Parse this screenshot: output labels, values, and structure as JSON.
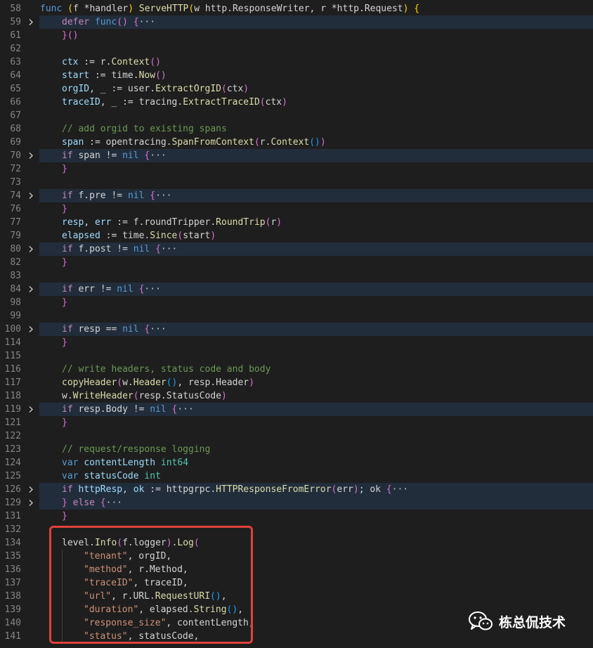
{
  "editor": {
    "lines": [
      {
        "num": "58",
        "fold": false,
        "indent": 0,
        "tokens": [
          [
            "kw",
            "func"
          ],
          [
            "op",
            " "
          ],
          [
            "b1",
            "("
          ],
          [
            "op",
            "f *handler"
          ],
          [
            "b1",
            ")"
          ],
          [
            "op",
            " "
          ],
          [
            "fn",
            "ServeHTTP"
          ],
          [
            "b1",
            "("
          ],
          [
            "op",
            "w http.ResponseWriter, r *http.Request"
          ],
          [
            "b1",
            ")"
          ],
          [
            "op",
            " "
          ],
          [
            "b1",
            "{"
          ]
        ]
      },
      {
        "num": "59",
        "fold": true,
        "indent": 1,
        "tokens": [
          [
            "ctl",
            "defer"
          ],
          [
            "op",
            " "
          ],
          [
            "kw",
            "func"
          ],
          [
            "b2",
            "()"
          ],
          [
            "op",
            " "
          ],
          [
            "b2",
            "{"
          ],
          [
            "ell",
            "···"
          ]
        ]
      },
      {
        "num": "61",
        "fold": false,
        "indent": 1,
        "tokens": [
          [
            "b2",
            "}"
          ],
          [
            "b2",
            "()"
          ]
        ]
      },
      {
        "num": "62",
        "fold": false,
        "indent": 1,
        "tokens": []
      },
      {
        "num": "63",
        "fold": false,
        "indent": 1,
        "tokens": [
          [
            "var",
            "ctx"
          ],
          [
            "op",
            " := r."
          ],
          [
            "fn",
            "Context"
          ],
          [
            "b2",
            "()"
          ]
        ]
      },
      {
        "num": "64",
        "fold": false,
        "indent": 1,
        "tokens": [
          [
            "var",
            "start"
          ],
          [
            "op",
            " := time."
          ],
          [
            "fn",
            "Now"
          ],
          [
            "b2",
            "()"
          ]
        ]
      },
      {
        "num": "65",
        "fold": false,
        "indent": 1,
        "tokens": [
          [
            "var",
            "orgID"
          ],
          [
            "op",
            ", _ := user."
          ],
          [
            "fn",
            "ExtractOrgID"
          ],
          [
            "b2",
            "("
          ],
          [
            "op",
            "ctx"
          ],
          [
            "b2",
            ")"
          ]
        ]
      },
      {
        "num": "66",
        "fold": false,
        "indent": 1,
        "tokens": [
          [
            "var",
            "traceID"
          ],
          [
            "op",
            ", _ := tracing."
          ],
          [
            "fn",
            "ExtractTraceID"
          ],
          [
            "b2",
            "("
          ],
          [
            "op",
            "ctx"
          ],
          [
            "b2",
            ")"
          ]
        ]
      },
      {
        "num": "67",
        "fold": false,
        "indent": 1,
        "tokens": []
      },
      {
        "num": "68",
        "fold": false,
        "indent": 1,
        "tokens": [
          [
            "cmt",
            "// add orgid to existing spans"
          ]
        ]
      },
      {
        "num": "69",
        "fold": false,
        "indent": 1,
        "tokens": [
          [
            "var",
            "span"
          ],
          [
            "op",
            " := opentracing."
          ],
          [
            "fn",
            "SpanFromContext"
          ],
          [
            "b2",
            "("
          ],
          [
            "op",
            "r."
          ],
          [
            "fn",
            "Context"
          ],
          [
            "b3",
            "()"
          ],
          [
            "b2",
            ")"
          ]
        ]
      },
      {
        "num": "70",
        "fold": true,
        "indent": 1,
        "tokens": [
          [
            "ctl",
            "if"
          ],
          [
            "op",
            " span != "
          ],
          [
            "kw",
            "nil"
          ],
          [
            "op",
            " "
          ],
          [
            "b2",
            "{"
          ],
          [
            "ell",
            "···"
          ]
        ]
      },
      {
        "num": "72",
        "fold": false,
        "indent": 1,
        "tokens": [
          [
            "b2",
            "}"
          ]
        ]
      },
      {
        "num": "73",
        "fold": false,
        "indent": 1,
        "tokens": []
      },
      {
        "num": "74",
        "fold": true,
        "indent": 1,
        "tokens": [
          [
            "ctl",
            "if"
          ],
          [
            "op",
            " f.pre != "
          ],
          [
            "kw",
            "nil"
          ],
          [
            "op",
            " "
          ],
          [
            "b2",
            "{"
          ],
          [
            "ell",
            "···"
          ]
        ]
      },
      {
        "num": "76",
        "fold": false,
        "indent": 1,
        "tokens": [
          [
            "b2",
            "}"
          ]
        ]
      },
      {
        "num": "77",
        "fold": false,
        "indent": 1,
        "tokens": [
          [
            "var",
            "resp"
          ],
          [
            "op",
            ", "
          ],
          [
            "var",
            "err"
          ],
          [
            "op",
            " := f.roundTripper."
          ],
          [
            "fn",
            "RoundTrip"
          ],
          [
            "b2",
            "("
          ],
          [
            "op",
            "r"
          ],
          [
            "b2",
            ")"
          ]
        ]
      },
      {
        "num": "79",
        "fold": false,
        "indent": 1,
        "tokens": [
          [
            "var",
            "elapsed"
          ],
          [
            "op",
            " := time."
          ],
          [
            "fn",
            "Since"
          ],
          [
            "b2",
            "("
          ],
          [
            "op",
            "start"
          ],
          [
            "b2",
            ")"
          ]
        ]
      },
      {
        "num": "80",
        "fold": true,
        "indent": 1,
        "tokens": [
          [
            "ctl",
            "if"
          ],
          [
            "op",
            " f.post != "
          ],
          [
            "kw",
            "nil"
          ],
          [
            "op",
            " "
          ],
          [
            "b2",
            "{"
          ],
          [
            "ell",
            "···"
          ]
        ]
      },
      {
        "num": "82",
        "fold": false,
        "indent": 1,
        "tokens": [
          [
            "b2",
            "}"
          ]
        ]
      },
      {
        "num": "83",
        "fold": false,
        "indent": 1,
        "tokens": []
      },
      {
        "num": "84",
        "fold": true,
        "indent": 1,
        "tokens": [
          [
            "ctl",
            "if"
          ],
          [
            "op",
            " err != "
          ],
          [
            "kw",
            "nil"
          ],
          [
            "op",
            " "
          ],
          [
            "b2",
            "{"
          ],
          [
            "ell",
            "···"
          ]
        ]
      },
      {
        "num": "98",
        "fold": false,
        "indent": 1,
        "tokens": [
          [
            "b2",
            "}"
          ]
        ]
      },
      {
        "num": "99",
        "fold": false,
        "indent": 1,
        "tokens": []
      },
      {
        "num": "100",
        "fold": true,
        "indent": 1,
        "tokens": [
          [
            "ctl",
            "if"
          ],
          [
            "op",
            " resp == "
          ],
          [
            "kw",
            "nil"
          ],
          [
            "op",
            " "
          ],
          [
            "b2",
            "{"
          ],
          [
            "ell",
            "···"
          ]
        ]
      },
      {
        "num": "114",
        "fold": false,
        "indent": 1,
        "tokens": [
          [
            "b2",
            "}"
          ]
        ]
      },
      {
        "num": "115",
        "fold": false,
        "indent": 1,
        "tokens": []
      },
      {
        "num": "116",
        "fold": false,
        "indent": 1,
        "tokens": [
          [
            "cmt",
            "// write headers, status code and body"
          ]
        ]
      },
      {
        "num": "117",
        "fold": false,
        "indent": 1,
        "tokens": [
          [
            "fn",
            "copyHeader"
          ],
          [
            "b2",
            "("
          ],
          [
            "op",
            "w."
          ],
          [
            "fn",
            "Header"
          ],
          [
            "b3",
            "()"
          ],
          [
            "op",
            ", resp.Header"
          ],
          [
            "b2",
            ")"
          ]
        ]
      },
      {
        "num": "118",
        "fold": false,
        "indent": 1,
        "tokens": [
          [
            "op",
            "w."
          ],
          [
            "fn",
            "WriteHeader"
          ],
          [
            "b2",
            "("
          ],
          [
            "op",
            "resp.StatusCode"
          ],
          [
            "b2",
            ")"
          ]
        ]
      },
      {
        "num": "119",
        "fold": true,
        "indent": 1,
        "tokens": [
          [
            "ctl",
            "if"
          ],
          [
            "op",
            " resp.Body != "
          ],
          [
            "kw",
            "nil"
          ],
          [
            "op",
            " "
          ],
          [
            "b2",
            "{"
          ],
          [
            "ell",
            "···"
          ]
        ]
      },
      {
        "num": "121",
        "fold": false,
        "indent": 1,
        "tokens": [
          [
            "b2",
            "}"
          ]
        ]
      },
      {
        "num": "122",
        "fold": false,
        "indent": 1,
        "tokens": []
      },
      {
        "num": "123",
        "fold": false,
        "indent": 1,
        "tokens": [
          [
            "cmt",
            "// request/response logging"
          ]
        ]
      },
      {
        "num": "124",
        "fold": false,
        "indent": 1,
        "tokens": [
          [
            "kw",
            "var"
          ],
          [
            "op",
            " "
          ],
          [
            "var",
            "contentLength"
          ],
          [
            "op",
            " "
          ],
          [
            "type",
            "int64"
          ]
        ]
      },
      {
        "num": "125",
        "fold": false,
        "indent": 1,
        "tokens": [
          [
            "kw",
            "var"
          ],
          [
            "op",
            " "
          ],
          [
            "var",
            "statusCode"
          ],
          [
            "op",
            " "
          ],
          [
            "type",
            "int"
          ]
        ]
      },
      {
        "num": "126",
        "fold": true,
        "indent": 1,
        "tokens": [
          [
            "ctl",
            "if"
          ],
          [
            "op",
            " "
          ],
          [
            "var",
            "httpResp"
          ],
          [
            "op",
            ", "
          ],
          [
            "var",
            "ok"
          ],
          [
            "op",
            " := httpgrpc."
          ],
          [
            "fn",
            "HTTPResponseFromError"
          ],
          [
            "b2",
            "("
          ],
          [
            "op",
            "err"
          ],
          [
            "b2",
            ")"
          ],
          [
            "op",
            "; ok "
          ],
          [
            "b2",
            "{"
          ],
          [
            "ell",
            "···"
          ]
        ]
      },
      {
        "num": "129",
        "fold": true,
        "indent": 1,
        "tokens": [
          [
            "b2",
            "}"
          ],
          [
            "op",
            " "
          ],
          [
            "ctl",
            "else"
          ],
          [
            "op",
            " "
          ],
          [
            "b2",
            "{"
          ],
          [
            "ell",
            "···"
          ]
        ]
      },
      {
        "num": "131",
        "fold": false,
        "indent": 1,
        "tokens": [
          [
            "b2",
            "}"
          ]
        ]
      },
      {
        "num": "132",
        "fold": false,
        "indent": 1,
        "tokens": []
      },
      {
        "num": "134",
        "fold": false,
        "indent": 1,
        "tokens": [
          [
            "op",
            "level."
          ],
          [
            "fn",
            "Info"
          ],
          [
            "b2",
            "("
          ],
          [
            "op",
            "f.logger"
          ],
          [
            "b2",
            ")"
          ],
          [
            "op",
            "."
          ],
          [
            "fn",
            "Log"
          ],
          [
            "b2",
            "("
          ]
        ]
      },
      {
        "num": "135",
        "fold": false,
        "indent": 2,
        "tokens": [
          [
            "str",
            "\"tenant\""
          ],
          [
            "op",
            ", orgID,"
          ]
        ]
      },
      {
        "num": "136",
        "fold": false,
        "indent": 2,
        "tokens": [
          [
            "str",
            "\"method\""
          ],
          [
            "op",
            ", r.Method,"
          ]
        ]
      },
      {
        "num": "137",
        "fold": false,
        "indent": 2,
        "tokens": [
          [
            "str",
            "\"traceID\""
          ],
          [
            "op",
            ", traceID,"
          ]
        ]
      },
      {
        "num": "138",
        "fold": false,
        "indent": 2,
        "tokens": [
          [
            "str",
            "\"url\""
          ],
          [
            "op",
            ", r.URL."
          ],
          [
            "fn",
            "RequestURI"
          ],
          [
            "b3",
            "()"
          ],
          [
            "op",
            ","
          ]
        ]
      },
      {
        "num": "139",
        "fold": false,
        "indent": 2,
        "tokens": [
          [
            "str",
            "\"duration\""
          ],
          [
            "op",
            ", elapsed."
          ],
          [
            "fn",
            "String"
          ],
          [
            "b3",
            "()"
          ],
          [
            "op",
            ","
          ]
        ]
      },
      {
        "num": "140",
        "fold": false,
        "indent": 2,
        "tokens": [
          [
            "str",
            "\"response_size\""
          ],
          [
            "op",
            ", contentLength,"
          ]
        ]
      },
      {
        "num": "141",
        "fold": false,
        "indent": 2,
        "tokens": [
          [
            "str",
            "\"status\""
          ],
          [
            "op",
            ", statusCode,"
          ]
        ]
      }
    ]
  },
  "watermark": {
    "text": "栋总侃技术",
    "icon": "wechat-icon"
  },
  "colors": {
    "background": "#1e1e1e",
    "folded_line": "#222d3b",
    "highlight_border": "#e0413b"
  }
}
